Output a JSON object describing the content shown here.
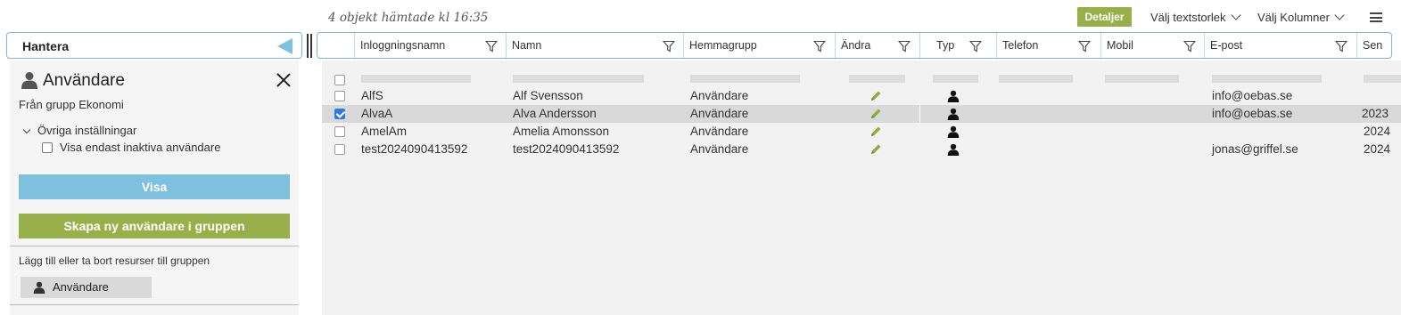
{
  "topbar": {
    "status": "4 objekt hämtade kl 16:35",
    "details_label": "Detaljer",
    "textsize_label": "Välj textstorlek",
    "columns_label": "Välj Kolumner"
  },
  "panel": {
    "hantera_label": "Hantera",
    "title": "Användare",
    "from_group": "Från grupp Ekonomi",
    "other_settings": "Övriga inställningar",
    "inactive_only": "Visa endast inaktiva användare",
    "show_button": "Visa",
    "create_button": "Skapa ny användare i gruppen",
    "resources_label": "Lägg till eller ta bort resurser till gruppen",
    "resource_chip": "Användare"
  },
  "table": {
    "columns": [
      "Inloggningsnamn",
      "Namn",
      "Hemmagrupp",
      "Ändra",
      "Typ",
      "Telefon",
      "Mobil",
      "E-post",
      "Sen"
    ],
    "rows": [
      {
        "login": "AlfS",
        "name": "Alf Svensson",
        "group": "Användare",
        "email": "info@oebas.se",
        "since": "",
        "checked": false
      },
      {
        "login": "AlvaA",
        "name": "Alva Andersson",
        "group": "Användare",
        "email": "info@oebas.se",
        "since": "2023",
        "checked": true
      },
      {
        "login": "AmelAm",
        "name": "Amelia Amonsson",
        "group": "Användare",
        "email": "",
        "since": "2024",
        "checked": false
      },
      {
        "login": "test2024090413592",
        "name": "test2024090413592",
        "group": "Användare",
        "email": "jonas@griffel.se",
        "since": "2024",
        "checked": false
      }
    ]
  },
  "colors": {
    "accent_green": "#98b04a",
    "accent_blue": "#7fc0de",
    "check_blue": "#2f7be3"
  }
}
